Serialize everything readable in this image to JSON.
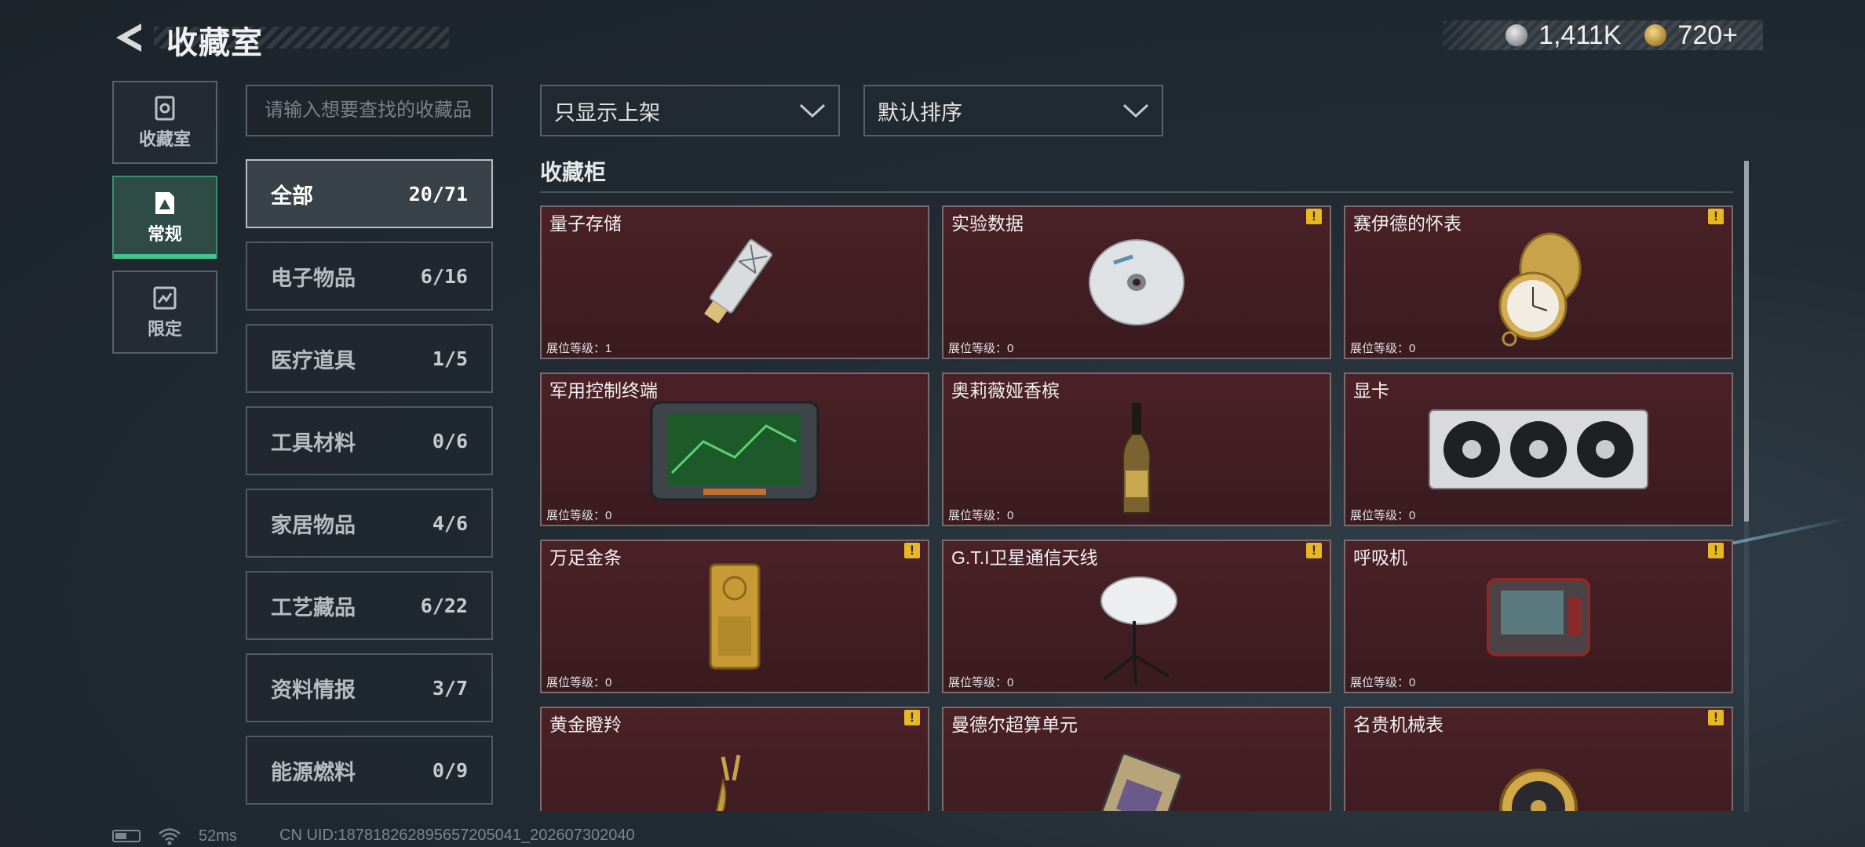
{
  "header": {
    "title": "收藏室",
    "back_icon": "back-arrow-icon"
  },
  "currency": [
    {
      "icon": "silver-coin-icon",
      "value": "1,411K"
    },
    {
      "icon": "gold-coin-icon",
      "value": "720+"
    }
  ],
  "nav": [
    {
      "label": "收藏室",
      "icon": "vault-icon",
      "active": false
    },
    {
      "label": "常规",
      "icon": "collection-icon",
      "active": true
    },
    {
      "label": "限定",
      "icon": "limited-icon",
      "active": false
    }
  ],
  "search": {
    "placeholder": "请输入想要查找的收藏品",
    "value": ""
  },
  "categories": [
    {
      "name": "全部",
      "count": "20/71",
      "active": true
    },
    {
      "name": "电子物品",
      "count": "6/16"
    },
    {
      "name": "医疗道具",
      "count": "1/5"
    },
    {
      "name": "工具材料",
      "count": "0/6"
    },
    {
      "name": "家居物品",
      "count": "4/6"
    },
    {
      "name": "工艺藏品",
      "count": "6/22"
    },
    {
      "name": "资料情报",
      "count": "3/7"
    },
    {
      "name": "能源燃料",
      "count": "0/9"
    }
  ],
  "filters": {
    "display": "只显示上架",
    "sort": "默认排序"
  },
  "section_title": "收藏柜",
  "items": [
    {
      "name": "量子存储",
      "level": "展位等级：1",
      "warn": false
    },
    {
      "name": "实验数据",
      "level": "展位等级：0",
      "warn": true
    },
    {
      "name": "赛伊德的怀表",
      "level": "展位等级：0",
      "warn": true
    },
    {
      "name": "军用控制终端",
      "level": "展位等级：0",
      "warn": false
    },
    {
      "name": "奥莉薇娅香槟",
      "level": "展位等级：0",
      "warn": false
    },
    {
      "name": "显卡",
      "level": "展位等级：0",
      "warn": false
    },
    {
      "name": "万足金条",
      "level": "展位等级：0",
      "warn": true
    },
    {
      "name": "G.T.I卫星通信天线",
      "level": "展位等级：0",
      "warn": true
    },
    {
      "name": "呼吸机",
      "level": "展位等级：0",
      "warn": true
    },
    {
      "name": "黄金瞪羚",
      "level": "",
      "warn": true
    },
    {
      "name": "曼德尔超算单元",
      "level": "",
      "warn": false
    },
    {
      "name": "名贵机械表",
      "level": "",
      "warn": true
    }
  ],
  "warn_mark": "!",
  "status": {
    "ping": "52ms",
    "uid": "CN UID:1878182628956572050​41_202607302040"
  }
}
